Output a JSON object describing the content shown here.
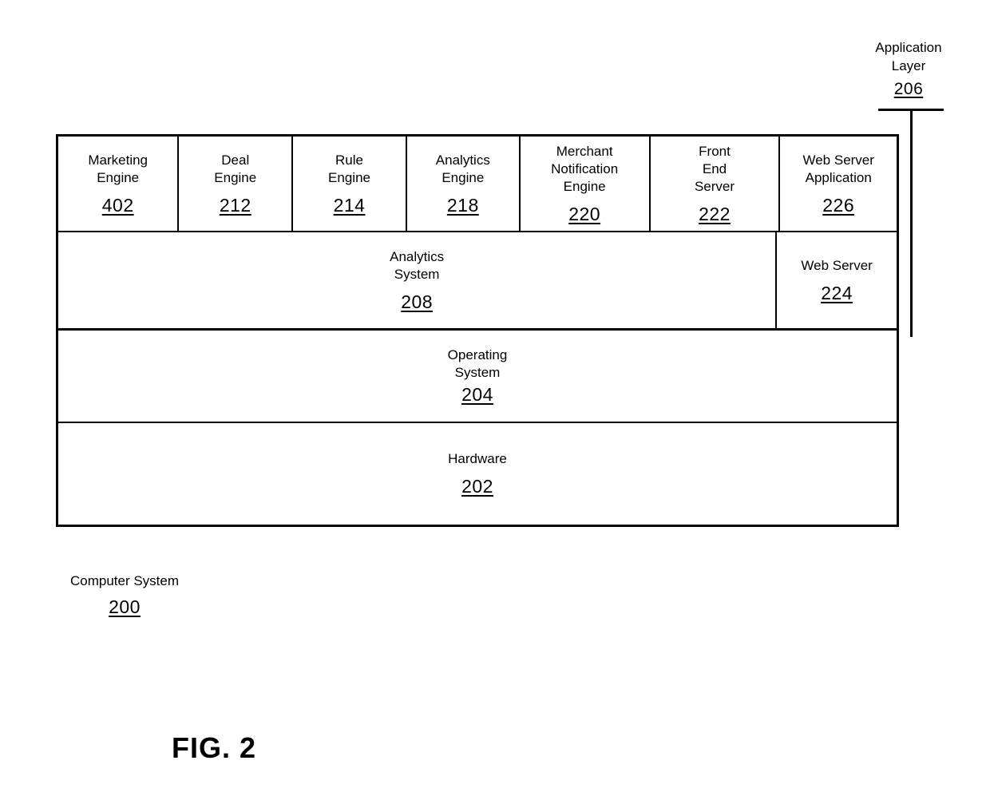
{
  "figure": {
    "caption": "FIG. 2"
  },
  "callouts": {
    "application_layer": {
      "label": "Application\nLayer",
      "ref": "206"
    },
    "computer_system": {
      "label": "Computer System",
      "ref": "200"
    }
  },
  "stack": {
    "rows": [
      {
        "name": "engines",
        "cells": [
          {
            "label": "Marketing\nEngine",
            "ref": "402",
            "flex": 152
          },
          {
            "label": "Deal\nEngine",
            "ref": "212",
            "flex": 143
          },
          {
            "label": "Rule\nEngine",
            "ref": "214",
            "flex": 143
          },
          {
            "label": "Analytics\nEngine",
            "ref": "218",
            "flex": 142
          },
          {
            "label": "Merchant\nNotification\nEngine",
            "ref": "220",
            "flex": 164
          },
          {
            "label": "Front\nEnd\nServer",
            "ref": "222",
            "flex": 164
          },
          {
            "label": "Web Server\nApplication",
            "ref": "226",
            "flex": 148
          }
        ]
      },
      {
        "name": "systems",
        "cells": [
          {
            "label": "Analytics\nSystem",
            "ref": "208",
            "flex": 908
          },
          {
            "label": "Web Server",
            "ref": "224",
            "flex": 148
          }
        ]
      },
      {
        "name": "operating-system",
        "cells": [
          {
            "label": "Operating\nSystem",
            "ref": "204",
            "flex": 1056
          }
        ]
      },
      {
        "name": "hardware",
        "cells": [
          {
            "label": "Hardware",
            "ref": "202",
            "flex": 1056
          }
        ]
      }
    ]
  }
}
